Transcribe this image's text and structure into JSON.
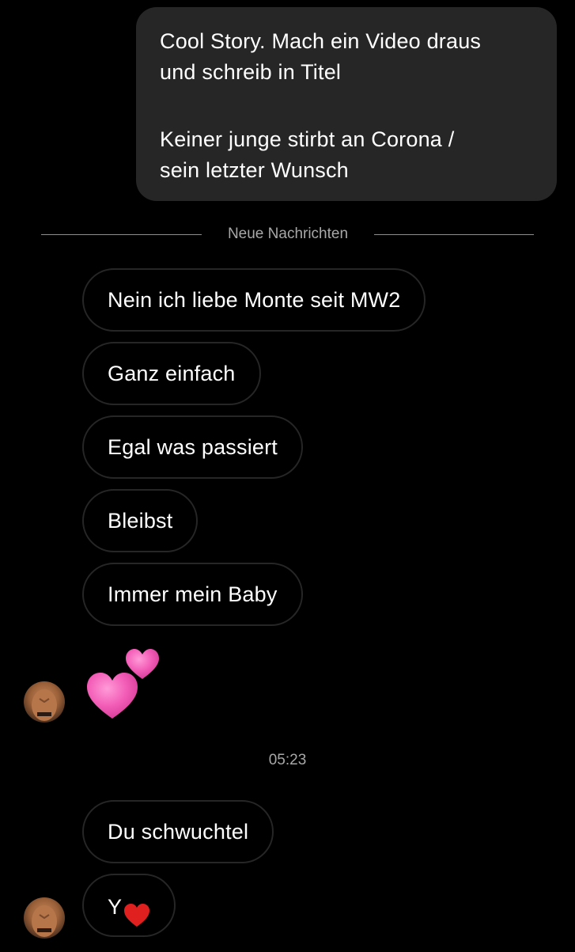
{
  "outgoing": {
    "line1": "Cool Story. Mach ein Video draus",
    "line2": "und schreib in Titel",
    "line3": "Keiner junge stirbt an Corona /",
    "line4": "sein letzter Wunsch"
  },
  "divider": {
    "label": "Neue Nachrichten"
  },
  "incoming": [
    {
      "text": "Nein ich liebe Monte seit MW2"
    },
    {
      "text": "Ganz einfach"
    },
    {
      "text": "Egal was passiert"
    },
    {
      "text": "Bleibst"
    },
    {
      "text": "Immer mein Baby"
    }
  ],
  "reaction": {
    "icon": "two-hearts-icon",
    "color": "#f25cb6"
  },
  "timestamp": "05:23",
  "incoming2": [
    {
      "text": "Du schwuchtel"
    },
    {
      "text": "Y",
      "icon": "red-heart-icon",
      "icon_color": "#e0201f"
    }
  ],
  "colors": {
    "background": "#000000",
    "outgoing_bubble": "#262626",
    "incoming_border": "#262626",
    "muted_text": "#a8a8a8"
  }
}
